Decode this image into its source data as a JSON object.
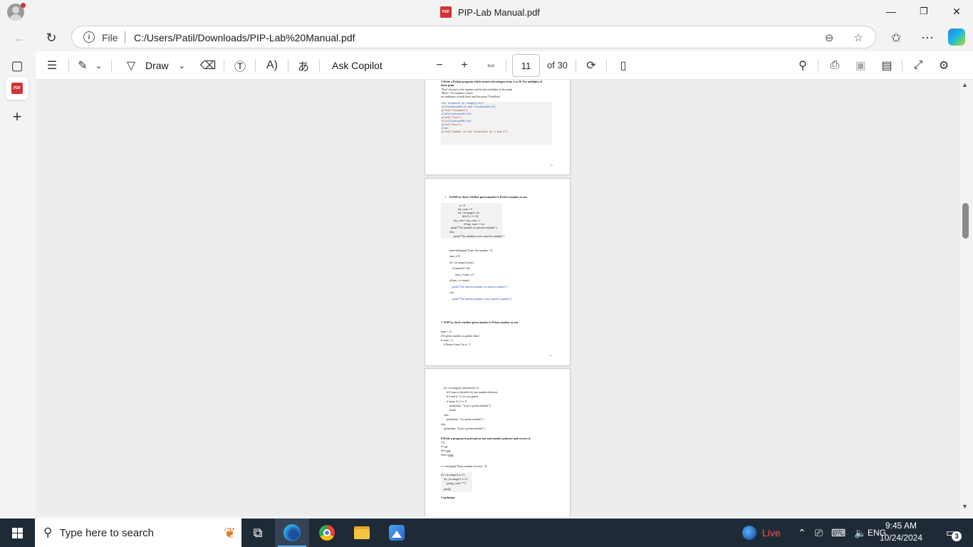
{
  "window": {
    "title": "PIP-Lab Manual.pdf",
    "minimize_icon": "—",
    "restore_icon": "❐",
    "close_icon": "✕"
  },
  "address_bar": {
    "file_label": "File",
    "url": "C:/Users/Patil/Downloads/PIP-Lab%20Manual.pdf"
  },
  "pdf_toolbar": {
    "draw_label": "Draw",
    "ask_copilot_label": "Ask Copilot",
    "current_page": "11",
    "total_pages": "of 30"
  },
  "pages": {
    "p1": {
      "heading1": "5.Write a Python program which iterates the integers from 1 to 50. For multiples of",
      "heading2": "three print",
      "line1": "\"Fizz\" instead of the number and for the multiples of five print",
      "line2": "\"Buzz\". For numbers which",
      "line3": "are multiples of both three and five print \"FizzBuzz\".",
      "code": [
        "for fizzbuzz in range(1,51):",
        " if(fizzbuzz%3==0 and fizzbuzz%5==0):",
        "  print(\"fizzbuzz\")",
        " elif(fizzbuzz%3==0):",
        "  print(\"fizz\")",
        " elif(fizzbuzz%5==0):",
        "  print(\"buzz\")",
        " else:",
        "  print(\"number is not divisible by 3 and 5\")"
      ],
      "page_number": "10"
    },
    "p2": {
      "heading": "6.WAP to check whether given number is Perfect number or not",
      "code_a": [
        "n = 6",
        "my_sum = 0",
        "for i in range(1, n):",
        "if(n % i == 0):",
        "my_sum = my_sum + i",
        "if (my_sum == n):",
        "print(\"The number is a perfect number\")",
        "else:",
        "print(\"The number is not a perfect number\")"
      ],
      "code_b": [
        "num=int(input(\"Enter the number: \"))",
        "sum_v=0",
        "for i in range(1,num):",
        "if (num%i==0):",
        "sum_v=sum_v+i",
        "if(sum_v==num):",
        "print(\"The entered number is a perfect number\")",
        "else:",
        "print(\"The entered number is not a perfect number\")"
      ],
      "heading2": "7. WAP to check whether given number is Prime number or not",
      "code_c": [
        "num = 11",
        "# If given number is greater than 1",
        "if num > 1:",
        "# Iterate from 2 to n / 2"
      ],
      "page_number": "11"
    },
    "p3": {
      "code_a": [
        "for i in range(2, int(num/2)+1):",
        "# If num is divisible by any number between",
        "# 2 and n / 2, it is not prime",
        "if (num % i) == 0:",
        "print(num, \"is not a prime number\")",
        "break",
        "else:",
        "print(num, \"is a prime number\")",
        "else:",
        "print(num, \"is not a prime number\")"
      ],
      "heading": "8.Write a program to print given star and number patterns and reverse it.",
      "pattern": [
        "* 1",
        "** 12",
        "*** 123",
        "**** 1234"
      ],
      "code_b": [
        "n = int(input(\"Enter number of rows: \"))",
        "for i in range(1,n+1):",
        "for j in range(1, i+1):",
        "print(j, end=\"*\")",
        "print()"
      ],
      "conclusion": "Conclusion:"
    }
  },
  "taskbar": {
    "search_placeholder": "Type here to search",
    "live_label": "Live",
    "language": "ENG",
    "time": "9:45 AM",
    "date": "10/24/2024",
    "notification_count": "3"
  }
}
